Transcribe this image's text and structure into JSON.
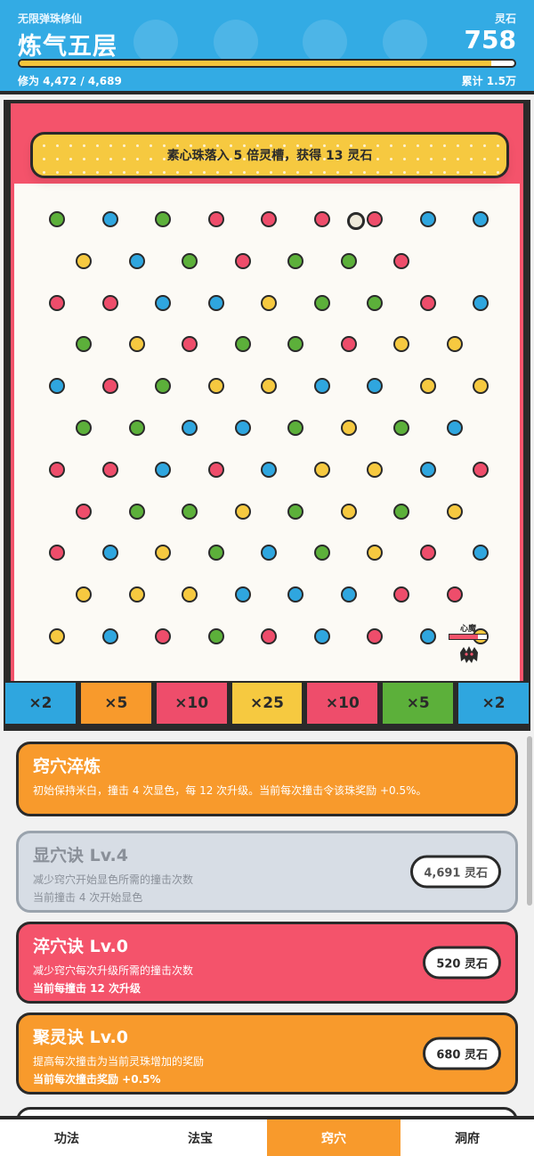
{
  "header": {
    "subtitle": "无限弹珠修仙",
    "title": "炼气五层",
    "stone_label": "灵石",
    "stone_value": "758",
    "progress_text": "修为 4,472 / 4,689",
    "progress_fraction": 0.954,
    "total_text": "累计 1.5万"
  },
  "board": {
    "banner": "素心珠落入 5 倍灵槽，获得 13 灵石",
    "peg_colors": {
      "G": "#5cb03a",
      "B": "#2fa6df",
      "R": "#ee4d6b",
      "Y": "#f6c940"
    },
    "peg_rows": [
      "GBGRRRRBB",
      "YBGRGGR",
      "RRBBYGGRB",
      "GYRGGRYY",
      "BRGYYBBYY",
      "GGBBGYGB",
      "RRBRBYYBR",
      "RGGYGYGY",
      "RBYGBGYRB",
      "YYYBBBRR",
      "YBRGRBRBY"
    ],
    "demon": {
      "label": "心魔",
      "hp_fraction": 0.75
    },
    "slots": [
      {
        "label": "×2",
        "color": "#2fa6df"
      },
      {
        "label": "×5",
        "color": "#f89a2c"
      },
      {
        "label": "×10",
        "color": "#ee4d6b"
      },
      {
        "label": "×25",
        "color": "#f6c940"
      },
      {
        "label": "×10",
        "color": "#ee4d6b"
      },
      {
        "label": "×5",
        "color": "#5cb03a"
      },
      {
        "label": "×2",
        "color": "#2fa6df"
      }
    ]
  },
  "upgrades": {
    "intro": {
      "title": "窍穴淬炼",
      "desc": "初始保持米白，撞击 4 次显色，每 12 次升级。当前每次撞击令该珠奖励 +0.5%。",
      "color": "#f89a2c"
    },
    "items": [
      {
        "title": "显穴诀 Lv.4",
        "desc": "减少窍穴开始显色所需的撞击次数",
        "current": "当前撞击 4 次开始显色",
        "cost": "4,691 灵石",
        "state": "locked"
      },
      {
        "title": "淬穴诀 Lv.0",
        "desc": "减少窍穴每次升级所需的撞击次数",
        "current": "当前每撞击 12 次升级",
        "cost": "520 灵石",
        "color": "#f4536b"
      },
      {
        "title": "聚灵诀 Lv.0",
        "desc": "提高每次撞击为当前灵珠增加的奖励",
        "current": "当前每次撞击奖励 +0.5%",
        "cost": "680 灵石",
        "color": "#f89a2c"
      }
    ]
  },
  "nav": {
    "items": [
      "功法",
      "法宝",
      "窍穴",
      "洞府"
    ],
    "active_index": 2,
    "active_color": "#f89a2c"
  }
}
